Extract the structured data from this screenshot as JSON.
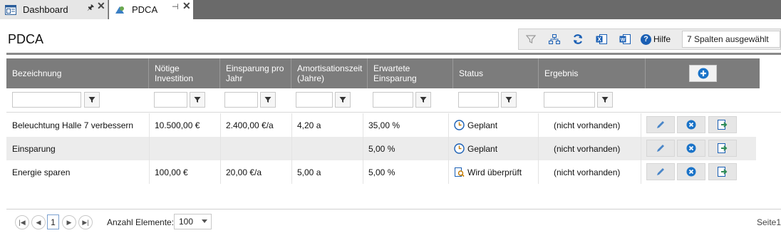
{
  "tabs": [
    {
      "label": "Dashboard",
      "icon": "dashboard-icon"
    },
    {
      "label": "PDCA",
      "icon": "pdca-icon"
    }
  ],
  "page": {
    "title": "PDCA"
  },
  "toolbar": {
    "help_label": "Hilfe",
    "columns_selected": "7 Spalten ausgewählt",
    "icons": [
      "filter-icon",
      "hierarchy-icon",
      "refresh-icon",
      "excel-export-icon",
      "word-export-icon",
      "help-icon"
    ]
  },
  "grid": {
    "columns": [
      "Bezeichnung",
      "Nötige Investition",
      "Einsparung pro Jahr",
      "Amortisationszeit (Jahre)",
      "Erwartete Einsparung",
      "Status",
      "Ergebnis"
    ],
    "rows": [
      {
        "name": "Beleuchtung Halle 7 verbessern",
        "investition": "10.500,00 €",
        "einsparung": "2.400,00 €/a",
        "amortisation": "4,20 a",
        "erwartet": "35,00 %",
        "status": "Geplant",
        "status_icon": "clock-icon",
        "ergebnis": "(nicht vorhanden)"
      },
      {
        "name": "Einsparung",
        "investition": "",
        "einsparung": "",
        "amortisation": "",
        "erwartet": "5,00 %",
        "status": "Geplant",
        "status_icon": "clock-icon",
        "ergebnis": "(nicht vorhanden)"
      },
      {
        "name": "Energie sparen",
        "investition": "100,00 €",
        "einsparung": "20,00 €/a",
        "amortisation": "5,00 a",
        "erwartet": "5,00 %",
        "status": "Wird überprüft",
        "status_icon": "review-icon",
        "ergebnis": "(nicht vorhanden)"
      }
    ]
  },
  "pager": {
    "current_page": "1",
    "items_label": "Anzahl Elemente:",
    "page_size": "100",
    "page_info": "Seite1"
  },
  "colors": {
    "header_bg": "#7c7c7c",
    "tab_bg": "#6a6a6a",
    "accent": "#1a73c8"
  }
}
